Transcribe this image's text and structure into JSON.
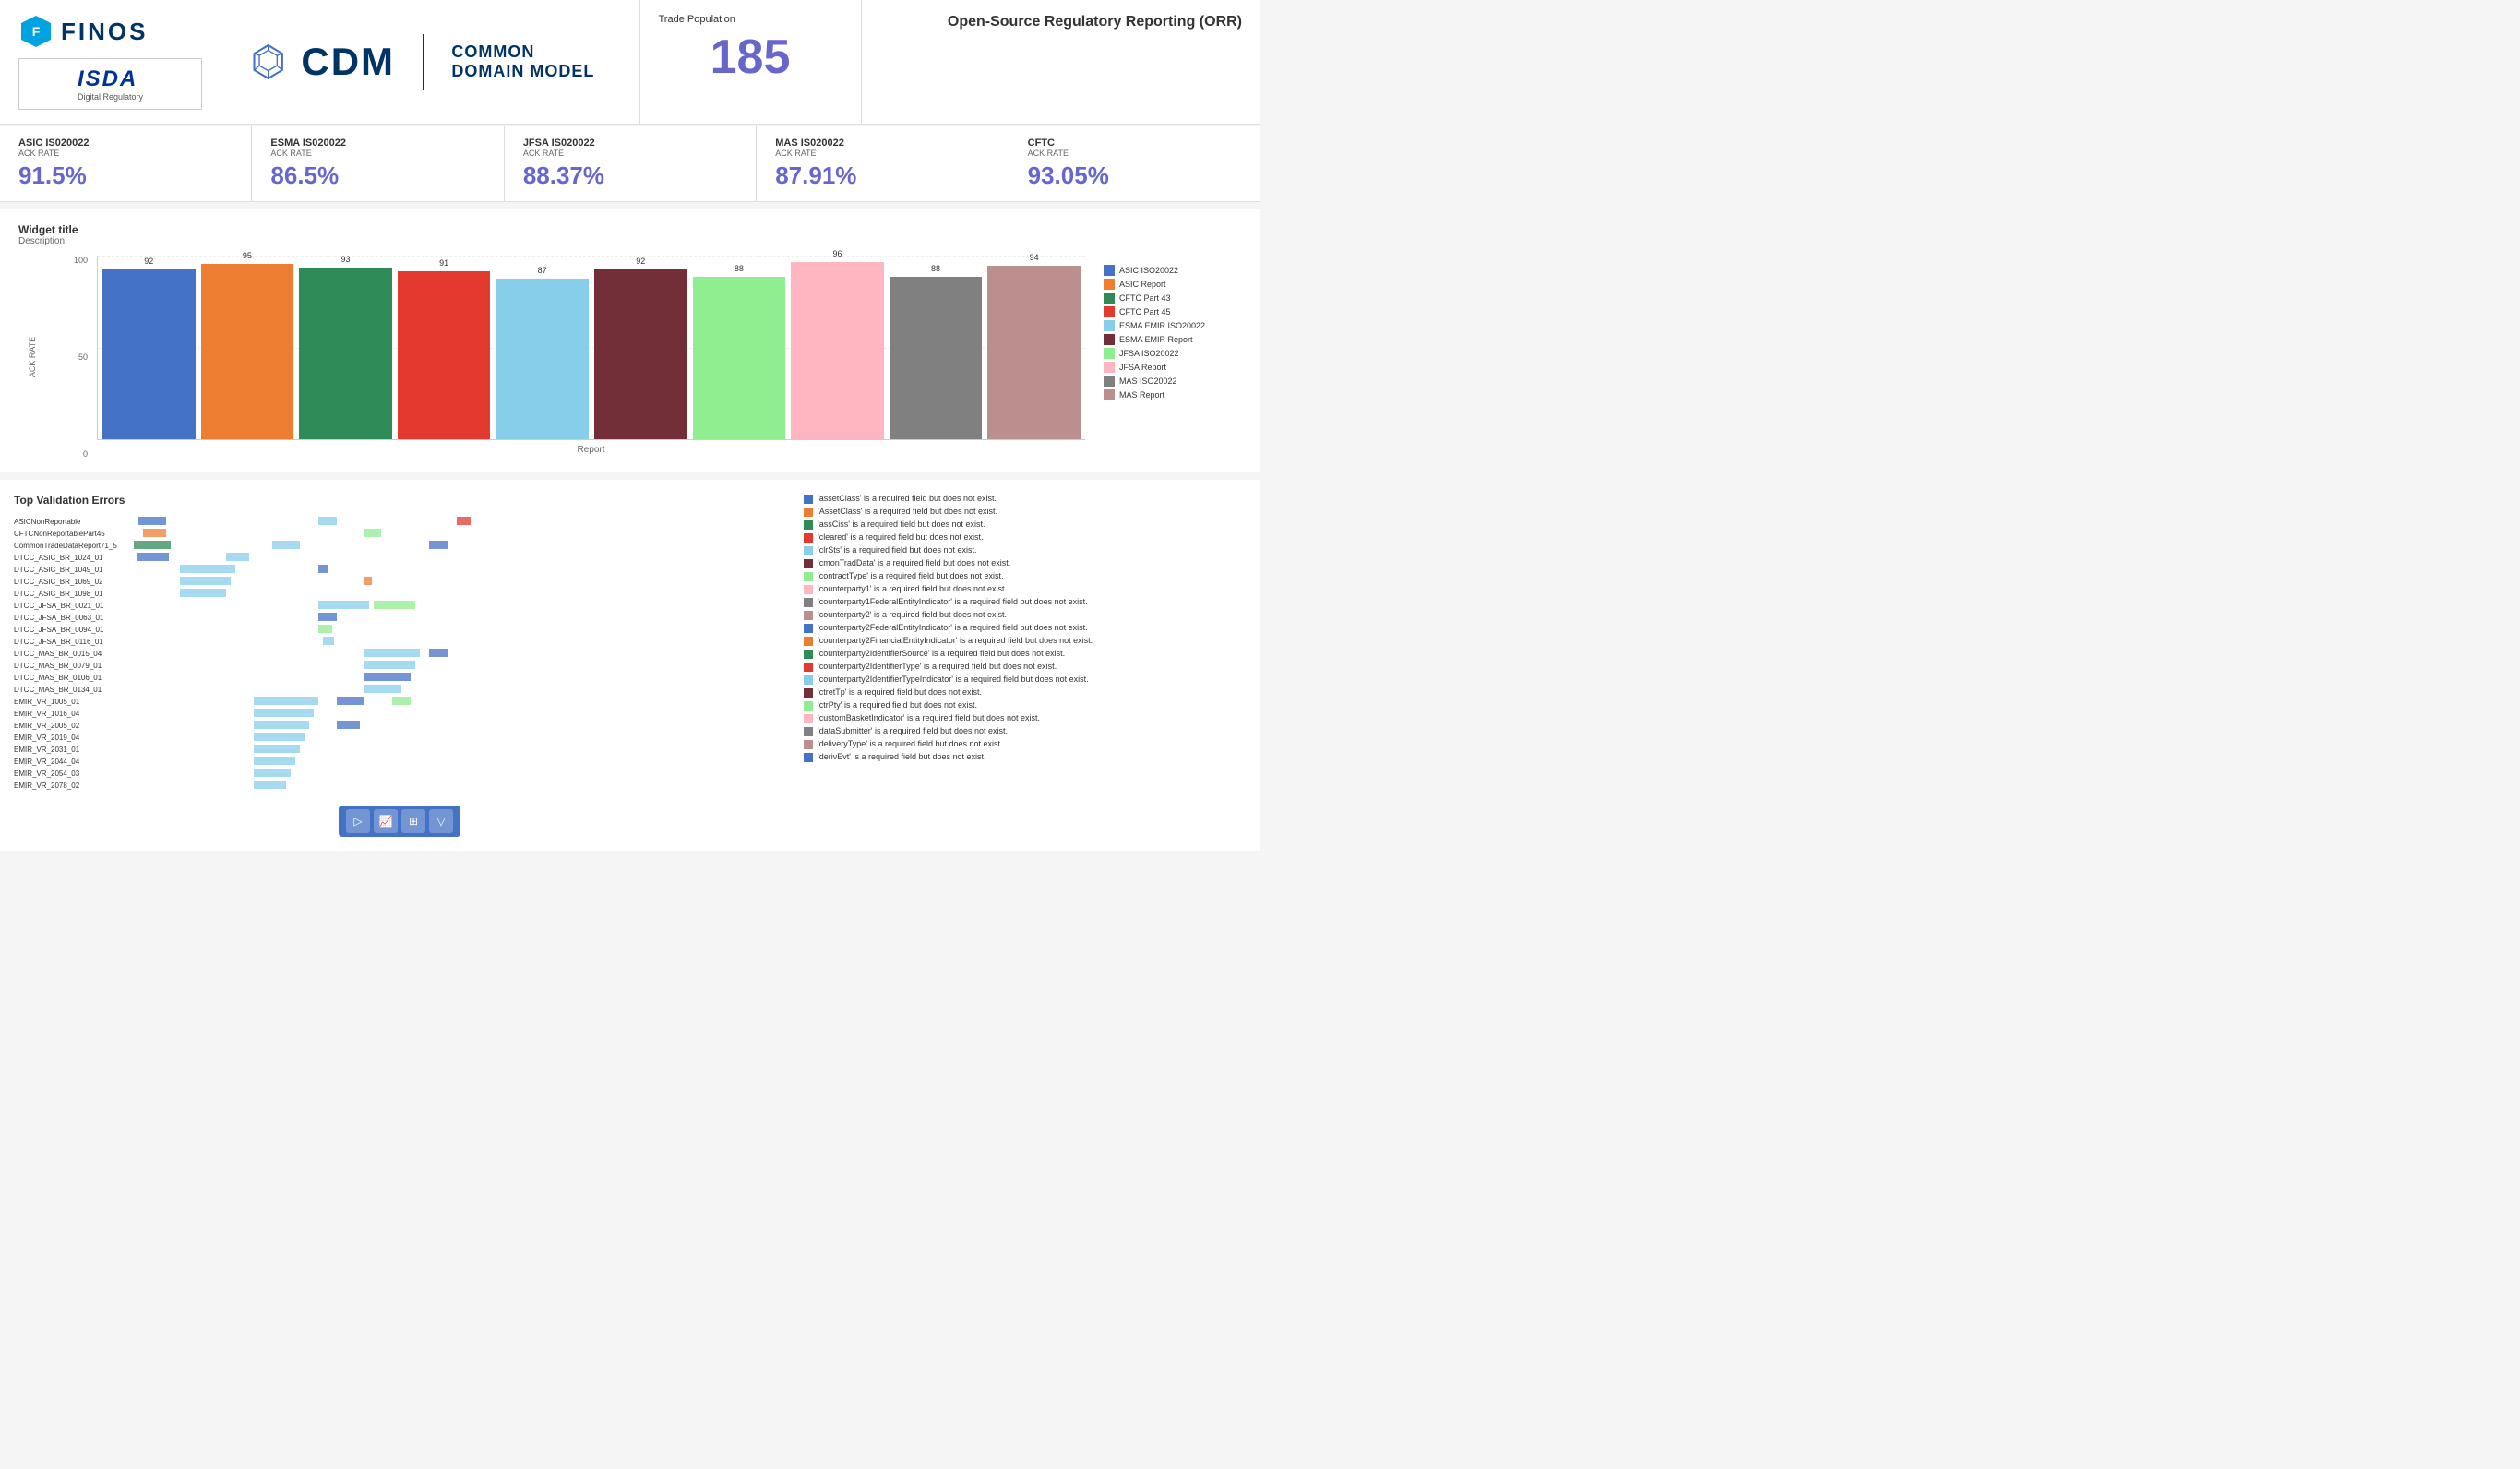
{
  "header": {
    "finos_text": "FINOS",
    "isda_text": "ISDA",
    "isda_subtitle": "Digital Regulatory",
    "cdm_text": "CDM",
    "cdm_subtitle": "COMMON DOMAIN MODEL",
    "trade_pop_label": "Trade Population",
    "trade_pop_value": "185",
    "orr_title": "Open-Source Regulatory Reporting (ORR)"
  },
  "ack_rates": [
    {
      "regulator": "ASIC IS020022",
      "label": "ACK RATE",
      "value": "91.5%"
    },
    {
      "regulator": "ESMA IS020022",
      "label": "ACK RATE",
      "value": "86.5%"
    },
    {
      "regulator": "JFSA IS020022",
      "label": "ACK RATE",
      "value": "88.37%"
    },
    {
      "regulator": "MAS IS020022",
      "label": "ACK RATE",
      "value": "87.91%"
    },
    {
      "regulator": "CFTC",
      "label": "ACK RATE",
      "value": "93.05%"
    }
  ],
  "chart": {
    "title": "Widget title",
    "description": "Description",
    "y_axis_labels": [
      "100",
      "50",
      "0"
    ],
    "x_axis_label": "Report",
    "y_axis_title": "ACK RATE",
    "bars": [
      {
        "value": 92,
        "color": "#4472C4",
        "label": "92"
      },
      {
        "value": 95,
        "color": "#ED7D31",
        "label": "95"
      },
      {
        "value": 93,
        "color": "#2E8B57",
        "label": "93"
      },
      {
        "value": 91,
        "color": "#E23A2E",
        "label": "91"
      },
      {
        "value": 87,
        "color": "#87CEEB",
        "label": "87"
      },
      {
        "value": 92,
        "color": "#722F37",
        "label": "92"
      },
      {
        "value": 88,
        "color": "#90EE90",
        "label": "88"
      },
      {
        "value": 96,
        "color": "#FFB6C1",
        "label": "96"
      },
      {
        "value": 88,
        "color": "#808080",
        "label": "88"
      },
      {
        "value": 94,
        "color": "#BC8F8F",
        "label": "94"
      }
    ],
    "legend": [
      {
        "label": "ASIC ISO20022",
        "color": "#4472C4"
      },
      {
        "label": "ASIC Report",
        "color": "#ED7D31"
      },
      {
        "label": "CFTC Part 43",
        "color": "#2E8B57"
      },
      {
        "label": "CFTC Part 45",
        "color": "#E23A2E"
      },
      {
        "label": "ESMA EMIR ISO20022",
        "color": "#87CEEB"
      },
      {
        "label": "ESMA EMIR Report",
        "color": "#722F37"
      },
      {
        "label": "JFSA ISO20022",
        "color": "#90EE90"
      },
      {
        "label": "JFSA Report",
        "color": "#FFB6C1"
      },
      {
        "label": "MAS ISO20022",
        "color": "#808080"
      },
      {
        "label": "MAS Report",
        "color": "#BC8F8F"
      }
    ]
  },
  "heatmap": {
    "title": "Top Validation Errors",
    "row_labels": [
      "ASICNonReportable",
      "CFTCNonReportablePart45",
      "CommonTradeDataReport71_5",
      "DTCC_ASIC_BR_1024_01",
      "DTCC_ASIC_BR_1049_01",
      "DTCC_ASIC_BR_1069_02",
      "DTCC_ASIC_BR_1098_01",
      "DTCC_JFSA_BR_0021_01",
      "DTCC_JFSA_BR_0063_01",
      "DTCC_JFSA_BR_0094_01",
      "DTCC_JFSA_BR_0116_01",
      "DTCC_MAS_BR_0015_04",
      "DTCC_MAS_BR_0079_01",
      "DTCC_MAS_BR_0106_01",
      "DTCC_MAS_BR_0134_01",
      "EMIR_VR_1005_01",
      "EMIR_VR_1016_04",
      "EMIR_VR_2005_02",
      "EMIR_VR_2019_04",
      "EMIR_VR_2031_01",
      "EMIR_VR_2044_04",
      "EMIR_VR_2054_03",
      "EMIR_VR_2078_02"
    ]
  },
  "errors": [
    {
      "color": "#4472C4",
      "text": "'assetClass' is a required field but does not exist."
    },
    {
      "color": "#ED7D31",
      "text": "'AssetClass' is a required field but does not exist."
    },
    {
      "color": "#2E8B57",
      "text": "'assCiss' is a required field but does not exist."
    },
    {
      "color": "#E23A2E",
      "text": "'cleared' is a required field but does not exist."
    },
    {
      "color": "#87CEEB",
      "text": "'clrSts' is a required field but does not exist."
    },
    {
      "color": "#722F37",
      "text": "'cmonTradData' is a required field but does not exist."
    },
    {
      "color": "#90EE90",
      "text": "'contractType' is a required field but does not exist."
    },
    {
      "color": "#FFB6C1",
      "text": "'counterparty1' is a required field but does not exist."
    },
    {
      "color": "#808080",
      "text": "'counterparty1FederalEntityIndicator' is a required field but does not exist."
    },
    {
      "color": "#BC8F8F",
      "text": "'counterparty2' is a required field but does not exist."
    },
    {
      "color": "#4472C4",
      "text": "'counterparty2FederalEntityIndicator' is a required field but does not exist."
    },
    {
      "color": "#ED7D31",
      "text": "'counterparty2FinancialEntityIndicator' is a required field but does not exist."
    },
    {
      "color": "#2E8B57",
      "text": "'counterparty2IdentifierSource' is a required field but does not exist."
    },
    {
      "color": "#E23A2E",
      "text": "'counterparty2IdentifierType' is a required field but does not exist."
    },
    {
      "color": "#87CEEB",
      "text": "'counterparty2IdentifierTypeIndicator' is a required field but does not exist."
    },
    {
      "color": "#722F37",
      "text": "'ctretTp' is a required field but does not exist."
    },
    {
      "color": "#90EE90",
      "text": "'ctrPty' is a required field but does not exist."
    },
    {
      "color": "#FFB6C1",
      "text": "'customBasketIndicator' is a required field but does not exist."
    },
    {
      "color": "#808080",
      "text": "'dataSubmitter' is a required field but does not exist."
    },
    {
      "color": "#BC8F8F",
      "text": "'deliveryType' is a required field but does not exist."
    },
    {
      "color": "#4472C4",
      "text": "'derivEvt' is a required field but does not exist."
    }
  ],
  "toolbar": {
    "buttons": [
      "▷",
      "📈",
      "⊞",
      "▽"
    ]
  }
}
